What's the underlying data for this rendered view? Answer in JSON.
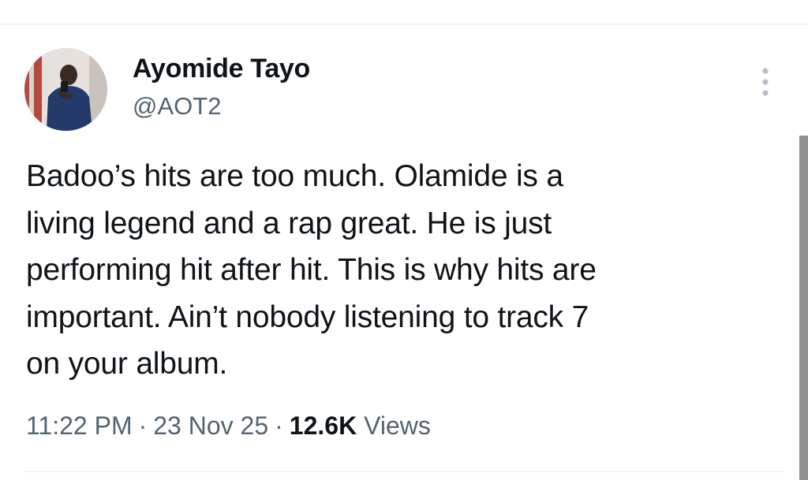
{
  "tweet": {
    "author": {
      "name": "Ayomide Tayo",
      "handle": "@AOT2",
      "avatar": "avatar-photo"
    },
    "text_lines": [
      "Badoo’s hits are too much. Olamide is a",
      "living legend and a rap great. He is just",
      "performing hit after hit. This is why hits are",
      "important. Ain’t nobody listening to track 7",
      "on your album."
    ],
    "meta": {
      "time": "11:22 PM",
      "separator": "·",
      "date": "23 Nov 25",
      "views_count": "12.6K",
      "views_label": "Views"
    },
    "icons": {
      "more": "more-vertical-icon"
    }
  },
  "colors": {
    "text_primary": "#0f1419",
    "text_secondary": "#536471",
    "divider": "#eceef0",
    "background": "#ffffff"
  }
}
